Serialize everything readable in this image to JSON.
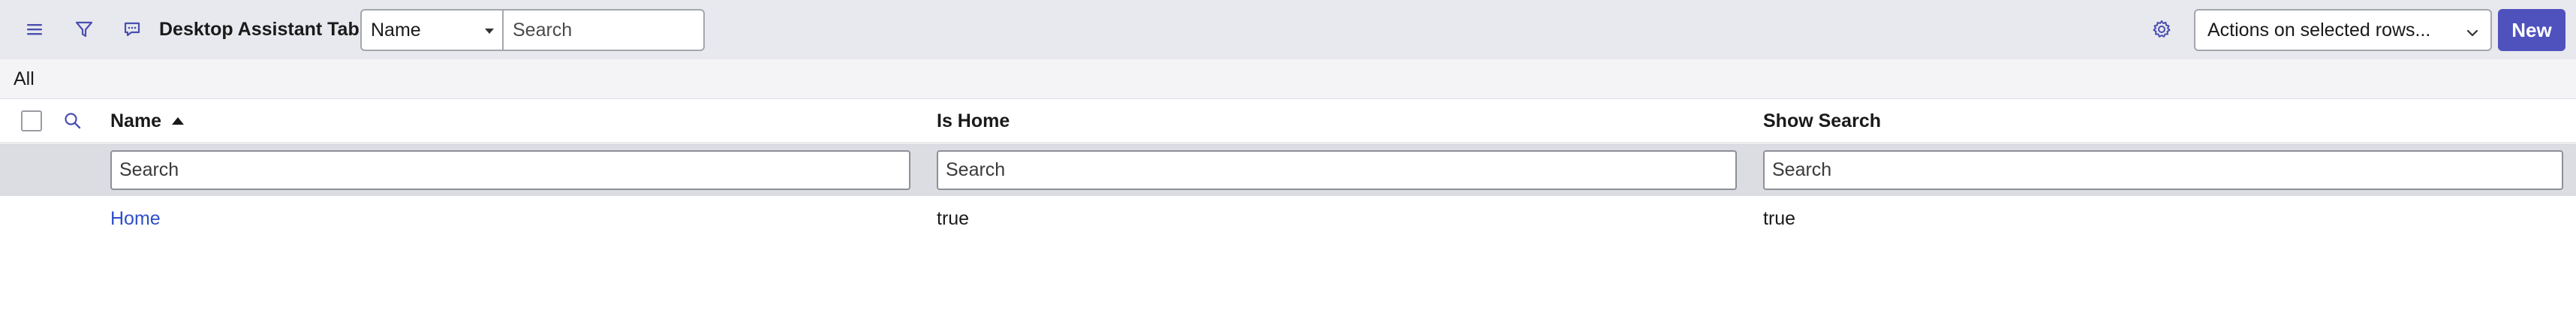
{
  "toolbar": {
    "title": "Desktop Assistant Tabs",
    "field_select_value": "Name",
    "search_placeholder": "Search",
    "actions_select_value": "Actions on selected rows...",
    "new_label": "New",
    "icons": {
      "menu": "hamburger-menu-icon",
      "filter": "filter-funnel-icon",
      "chat": "chat-bubble-icon",
      "settings": "gear-icon",
      "chevron": "chevron-down-icon"
    }
  },
  "breadcrumb": {
    "label": "All"
  },
  "table": {
    "columns": [
      {
        "label": "Name",
        "sorted": "ascending"
      },
      {
        "label": "Is Home"
      },
      {
        "label": "Show Search"
      }
    ],
    "filter_placeholder": "Search",
    "rows": [
      {
        "name": "Home",
        "is_home": "true",
        "show_search": "true"
      }
    ]
  },
  "colors": {
    "toolbar_bg": "#e8e9ee",
    "accent": "#4f52bd",
    "link": "#2d4fc8",
    "filter_row_bg": "#dcdde2"
  }
}
